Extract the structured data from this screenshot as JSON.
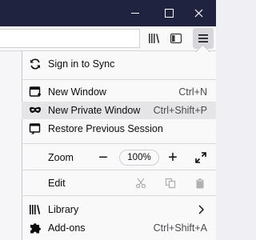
{
  "titlebar": {
    "minimize_glyph": "—",
    "close_glyph": "✕"
  },
  "menu": {
    "sync_label": "Sign in to Sync",
    "items": [
      {
        "label": "New Window",
        "shortcut": "Ctrl+N"
      },
      {
        "label": "New Private Window",
        "shortcut": "Ctrl+Shift+P"
      },
      {
        "label": "Restore Previous Session",
        "shortcut": ""
      }
    ],
    "zoom_label": "Zoom",
    "zoom_out": "−",
    "zoom_value": "100%",
    "zoom_in": "+",
    "edit_label": "Edit",
    "library_label": "Library",
    "addons_label": "Add-ons",
    "addons_shortcut": "Ctrl+Shift+A"
  },
  "colors": {
    "titlebar": "#202340",
    "highlight": "#e5e5e8",
    "panel": "#f9f9fa"
  }
}
